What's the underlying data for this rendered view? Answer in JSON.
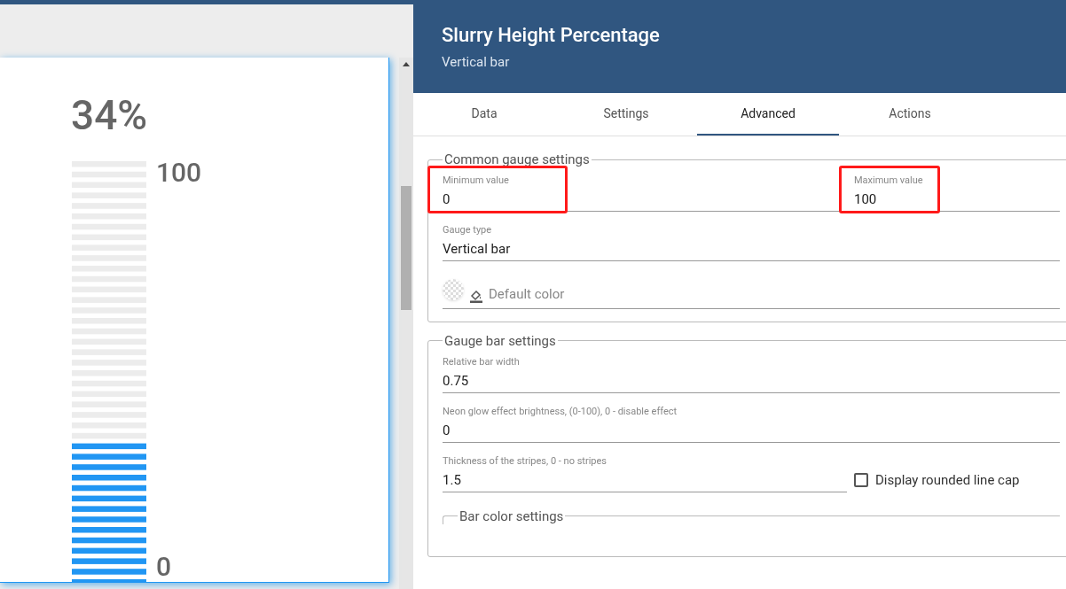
{
  "gauge": {
    "value_label": "34%",
    "max_label": "100",
    "min_label": "0",
    "level": 0.34
  },
  "panel": {
    "title": "Slurry Height Percentage",
    "subtitle": "Vertical bar"
  },
  "tabs": [
    {
      "label": "Data",
      "selected": false
    },
    {
      "label": "Settings",
      "selected": false
    },
    {
      "label": "Advanced",
      "selected": true
    },
    {
      "label": "Actions",
      "selected": false
    }
  ],
  "sections": [
    {
      "legend": "Common gauge settings",
      "rows": [
        {
          "kind": "pair",
          "fields": [
            {
              "label": "Minimum value",
              "value": "0",
              "highlighted": true
            },
            {
              "label": "Maximum value",
              "value": "100",
              "highlighted": true
            }
          ]
        },
        {
          "kind": "field",
          "label": "Gauge type",
          "value": "Vertical bar"
        },
        {
          "kind": "color",
          "placeholder": "Default color"
        }
      ]
    },
    {
      "legend": "Gauge bar settings",
      "rows": [
        {
          "kind": "field",
          "label": "Relative bar width",
          "value": "0.75"
        },
        {
          "kind": "field",
          "label": "Neon glow effect brightness, (0-100), 0 - disable effect",
          "value": "0"
        },
        {
          "kind": "field_checkbox",
          "label": "Thickness of the stripes, 0 - no stripes",
          "value": "1.5",
          "checkbox": {
            "label": "Display rounded line cap",
            "checked": false
          }
        }
      ],
      "subsection": {
        "legend": "Bar color settings"
      }
    }
  ]
}
